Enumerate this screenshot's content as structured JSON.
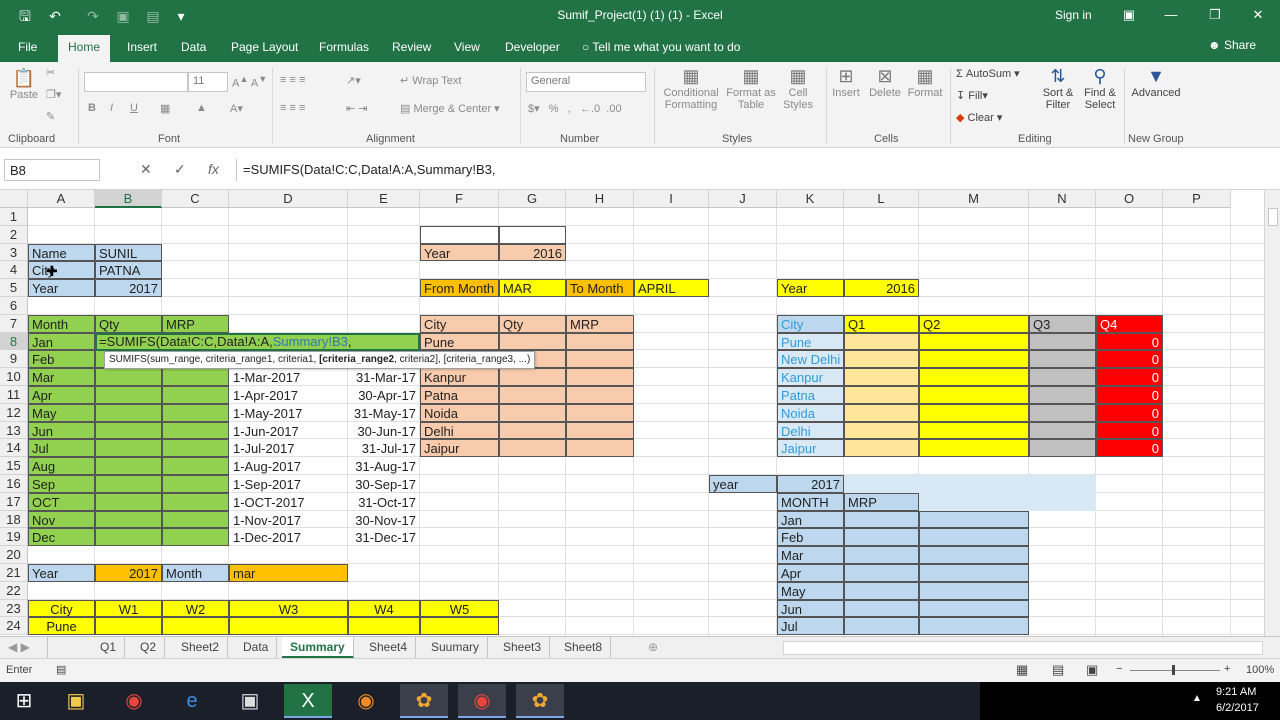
{
  "window": {
    "title": "Sumif_Project(1) (1) (1) - Excel",
    "sign_in": "Sign in",
    "share": "Share",
    "tell_me": "Tell me what you want to do"
  },
  "tabs": [
    "File",
    "Home",
    "Insert",
    "Data",
    "Page Layout",
    "Formulas",
    "Review",
    "View",
    "Developer"
  ],
  "ribbon": {
    "groups": [
      "Clipboard",
      "Font",
      "Alignment",
      "Number",
      "Styles",
      "Cells",
      "Editing",
      "New Group"
    ],
    "paste": "Paste",
    "font_size": "11",
    "wrap_text": "Wrap Text",
    "merge_center": "Merge & Center",
    "number_format": "General",
    "conditional_formatting": "Conditional Formatting",
    "format_as_table": "Format as Table",
    "cell_styles": "Cell Styles",
    "insert": "Insert",
    "delete": "Delete",
    "format": "Format",
    "autosum": "AutoSum",
    "fill": "Fill",
    "clear": "Clear",
    "sort_filter": "Sort & Filter",
    "find_select": "Find & Select",
    "advanced": "Advanced"
  },
  "formula_bar": {
    "name_box": "B8",
    "formula": "=SUMIFS(Data!C:C,Data!A:A,Summary!B3,"
  },
  "columns": [
    "A",
    "B",
    "C",
    "D",
    "E",
    "F",
    "G",
    "H",
    "I",
    "J",
    "K",
    "L",
    "M",
    "N",
    "O",
    "P"
  ],
  "rows": [
    "1",
    "2",
    "3",
    "4",
    "5",
    "6",
    "7",
    "8",
    "9",
    "10",
    "11",
    "12",
    "13",
    "14",
    "15",
    "16",
    "17",
    "18",
    "19",
    "20",
    "21",
    "22",
    "23",
    "24"
  ],
  "edit": {
    "formula_parts": [
      "=SUMIFS(Data!C:C,Data!A:A,",
      "Summary!B3",
      ","
    ],
    "tooltip_parts": [
      "SUMIFS(sum_range, criteria_range1, criteria1, ",
      "[criteria_range2",
      ", criteria2], [criteria_range3, ...)"
    ]
  },
  "cells": {
    "A3": "Name",
    "B3": "SUNIL",
    "A4": "City",
    "B4": "PATNA",
    "A5": "Year",
    "B5": "2017",
    "A7": "Month",
    "B7": "Qty",
    "C7": "MRP",
    "months": [
      "Jan",
      "Feb",
      "Mar",
      "Apr",
      "May",
      "Jun",
      "Jul",
      "Aug",
      "Sep",
      "OCT",
      "Nov",
      "Dec"
    ],
    "from_dates": [
      "1-Mar-2017",
      "1-Apr-2017",
      "1-May-2017",
      "1-Jun-2017",
      "1-Jul-2017",
      "1-Aug-2017",
      "1-Sep-2017",
      "1-OCT-2017",
      "1-Nov-2017",
      "1-Dec-2017"
    ],
    "to_dates": [
      "31-Mar-17",
      "30-Apr-17",
      "31-May-17",
      "30-Jun-17",
      "31-Jul-17",
      "31-Aug-17",
      "30-Sep-17",
      "31-Oct-17",
      "30-Nov-17",
      "31-Dec-17"
    ],
    "A21": "Year",
    "B21": "2017",
    "C21": "Month",
    "D21": "mar",
    "A23": "City",
    "week_headers": [
      "W1",
      "W2",
      "W3",
      "W4",
      "W5"
    ],
    "A24": "Pune",
    "F3": "Year",
    "G3": "2016",
    "F5": "From Month",
    "G5": "MAR",
    "H5": "To Month",
    "I5": "APRIL",
    "F7": "City",
    "G7": "Qty",
    "H7": "MRP",
    "cities": [
      "Pune",
      "Kanpur",
      "Patna",
      "Noida",
      "Delhi",
      "Jaipur"
    ],
    "K5": "Year",
    "L5": "2016",
    "K7": "City",
    "quarters": [
      "Q1",
      "Q2",
      "Q3",
      "Q4"
    ],
    "q_cities": [
      "Pune",
      "New Delhi",
      "Kanpur",
      "Patna",
      "Noida",
      "Delhi",
      "Jaipur"
    ],
    "q4_values": [
      "0",
      "0",
      "0",
      "0",
      "0",
      "0",
      "0"
    ],
    "J16": "year",
    "K16": "2017",
    "K17": "MONTH",
    "L17": "MRP",
    "k_months": [
      "Jan",
      "Feb",
      "Mar",
      "Apr",
      "May",
      "Jun",
      "Jul"
    ]
  },
  "sheet_tabs": [
    "Q1",
    "Q2",
    "Sheet2",
    "Data",
    "Summary",
    "Sheet4",
    "Suumary",
    "Sheet3",
    "Sheet8"
  ],
  "active_sheet": "Summary",
  "status": {
    "mode": "Enter",
    "zoom": "100%"
  },
  "clock": {
    "time": "9:21 AM",
    "date": "6/2/2017"
  },
  "colors": {
    "excel_green": "#217346",
    "blue": "#bdd7ee",
    "green": "#92d050",
    "salmon": "#f8cbad",
    "yellow": "#ffff00",
    "orange": "#ffc000",
    "red": "#ff0000"
  }
}
